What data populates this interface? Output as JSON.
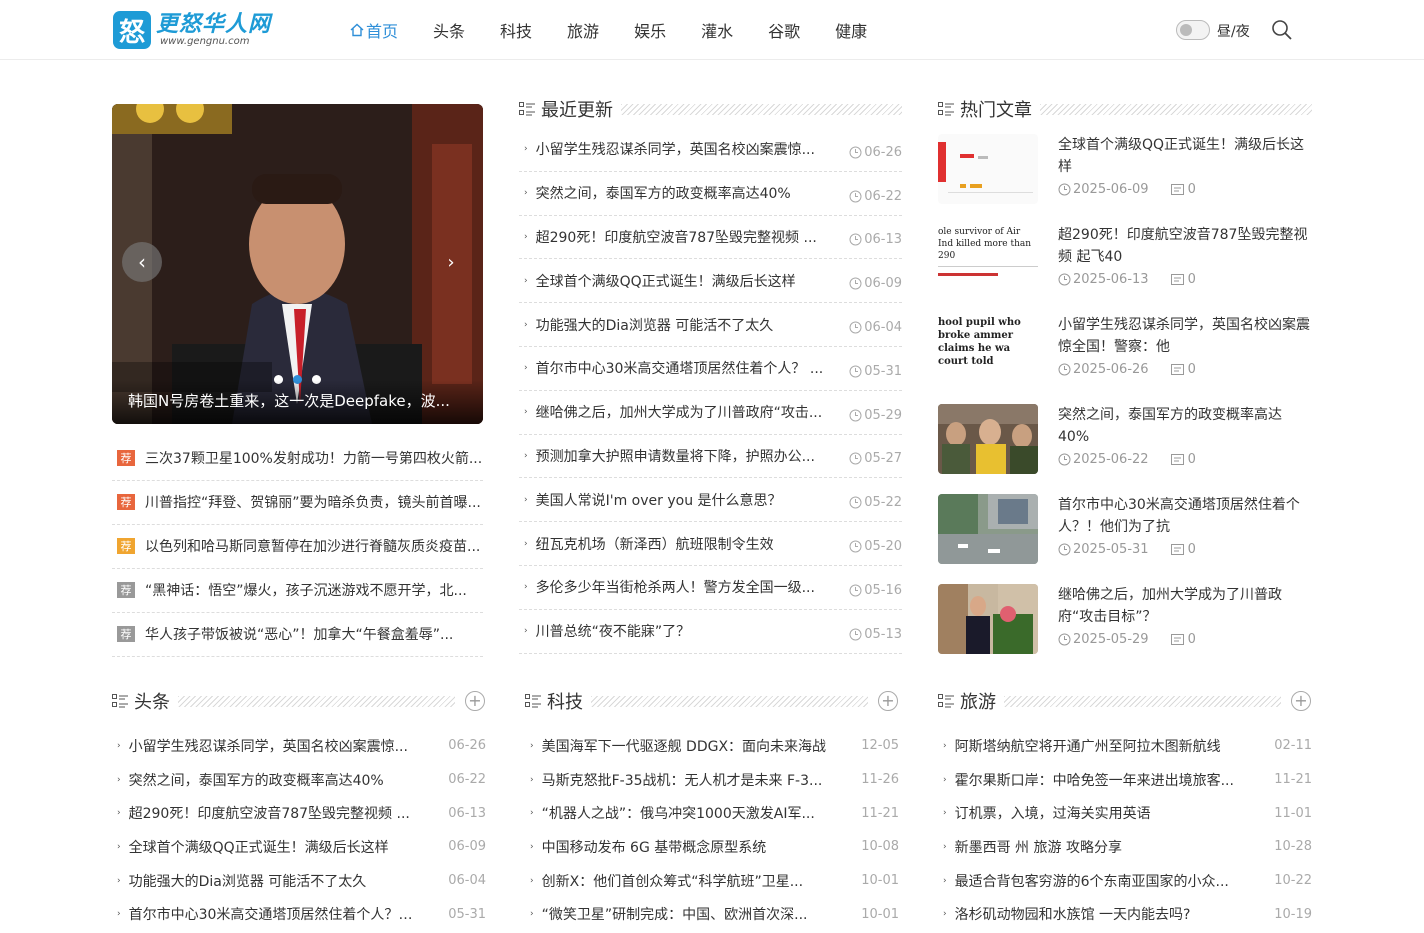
{
  "header": {
    "logo_name": "更怒华人网",
    "logo_mark": "怒",
    "logo_url": "www.gengnu.com",
    "nav": [
      "首页",
      "头条",
      "科技",
      "旅游",
      "娱乐",
      "灌水",
      "谷歌",
      "健康"
    ],
    "daynight_label": "昼/夜"
  },
  "slider": {
    "caption": "韩国N号房卷土重来，这一次是Deepfake，波...",
    "dots": 3,
    "active_dot": 1
  },
  "recommend": {
    "badge": "荐",
    "items": [
      {
        "text": "三次37颗卫星100%发射成功！力箭一号第四枚火箭...",
        "color": "#e8663d"
      },
      {
        "text": "川普指控“拜登、贺锦丽”要为暗杀负责，镜头前首曝...",
        "color": "#e8663d"
      },
      {
        "text": "以色列和哈马斯同意暂停在加沙进行脊髓灰质炎疫苗...",
        "color": "#f0a530"
      },
      {
        "text": "“黑神话：悟空”爆火，孩子沉迷游戏不愿开学，北...",
        "color": "#999999"
      },
      {
        "text": "华人孩子带饭被说“恶心”！加拿大“午餐盒羞辱”...",
        "color": "#999999"
      }
    ]
  },
  "recent": {
    "title": "最近更新",
    "items": [
      {
        "text": "小留学生残忍谋杀同学，英国名校凶案震惊...",
        "date": "06-26"
      },
      {
        "text": "突然之间，泰国军方的政变概率高达40%",
        "date": "06-22"
      },
      {
        "text": "超290死！印度航空波音787坠毁完整视频 ...",
        "date": "06-13"
      },
      {
        "text": "全球首个满级QQ正式诞生！满级后长这样",
        "date": "06-09"
      },
      {
        "text": "功能强大的Dia浏览器 可能活不了太久",
        "date": "06-04"
      },
      {
        "text": "首尔市中心30米高交通塔顶居然住着个人？ ...",
        "date": "05-31"
      },
      {
        "text": "继哈佛之后，加州大学成为了川普政府“攻击...",
        "date": "05-29"
      },
      {
        "text": "预测加拿大护照申请数量将下降，护照办公...",
        "date": "05-27"
      },
      {
        "text": "美国人常说I'm over you 是什么意思？",
        "date": "05-22"
      },
      {
        "text": "纽瓦克机场（新泽西）航班限制令生效",
        "date": "05-20"
      },
      {
        "text": "多伦多少年当街枪杀两人！警方发全国一级...",
        "date": "05-16"
      },
      {
        "text": "川普总统“夜不能寐”了？",
        "date": "05-13"
      }
    ]
  },
  "hot": {
    "title": "热门文章",
    "items": [
      {
        "title": "全球首个满级QQ正式诞生！满级后长这样",
        "date": "2025-06-09",
        "comments": "0"
      },
      {
        "title": "超290死！印度航空波音787坠毁完整视频 起飞40",
        "date": "2025-06-13",
        "comments": "0",
        "thumb_text": "ole survivor of Air Ind killed more than 290"
      },
      {
        "title": "小留学生残忍谋杀同学，英国名校凶案震惊全国！警察：他",
        "date": "2025-06-26",
        "comments": "0",
        "thumb_text": "hool pupil who broke ammer claims he wa court told"
      },
      {
        "title": "突然之间，泰国军方的政变概率高达40%",
        "date": "2025-06-22",
        "comments": "0"
      },
      {
        "title": "首尔市中心30米高交通塔顶居然住着个人？！他们为了抗",
        "date": "2025-05-31",
        "comments": "0"
      },
      {
        "title": "继哈佛之后，加州大学成为了川普政府“攻击目标”？",
        "date": "2025-05-29",
        "comments": "0"
      }
    ]
  },
  "columns": [
    {
      "title": "头条",
      "items": [
        {
          "text": "小留学生残忍谋杀同学，英国名校凶案震惊...",
          "date": "06-26"
        },
        {
          "text": "突然之间，泰国军方的政变概率高达40%",
          "date": "06-22"
        },
        {
          "text": "超290死！印度航空波音787坠毁完整视频 ...",
          "date": "06-13"
        },
        {
          "text": "全球首个满级QQ正式诞生！满级后长这样",
          "date": "06-09"
        },
        {
          "text": "功能强大的Dia浏览器 可能活不了太久",
          "date": "06-04"
        },
        {
          "text": "首尔市中心30米高交通塔顶居然住着个人？ ...",
          "date": "05-31"
        }
      ]
    },
    {
      "title": "科技",
      "items": [
        {
          "text": "美国海军下一代驱逐舰 DDGX：面向未来海战",
          "date": "12-05"
        },
        {
          "text": "马斯克怒批F-35战机：无人机才是未来 F-3...",
          "date": "11-26"
        },
        {
          "text": "“机器人之战”：俄乌冲突1000天激发AI军...",
          "date": "11-21"
        },
        {
          "text": "中国移动发布 6G 基带概念原型系统",
          "date": "10-08"
        },
        {
          "text": "创新X：他们首创众筹式“科学航班”卫星...",
          "date": "10-01"
        },
        {
          "text": "“微笑卫星”研制完成：中国、欧洲首次深...",
          "date": "10-01"
        }
      ]
    },
    {
      "title": "旅游",
      "items": [
        {
          "text": "阿斯塔纳航空将开通广州至阿拉木图新航线",
          "date": "02-11"
        },
        {
          "text": "霍尔果斯口岸：中哈免签一年来进出境旅客...",
          "date": "11-21"
        },
        {
          "text": "订机票，入境，过海关实用英语",
          "date": "11-01"
        },
        {
          "text": "新墨西哥 州 旅游 攻略分享",
          "date": "10-28"
        },
        {
          "text": "最适合背包客穷游的6个东南亚国家的小众...",
          "date": "10-22"
        },
        {
          "text": "洛杉矶动物园和水族馆 一天内能去吗?",
          "date": "10-19"
        }
      ]
    }
  ]
}
